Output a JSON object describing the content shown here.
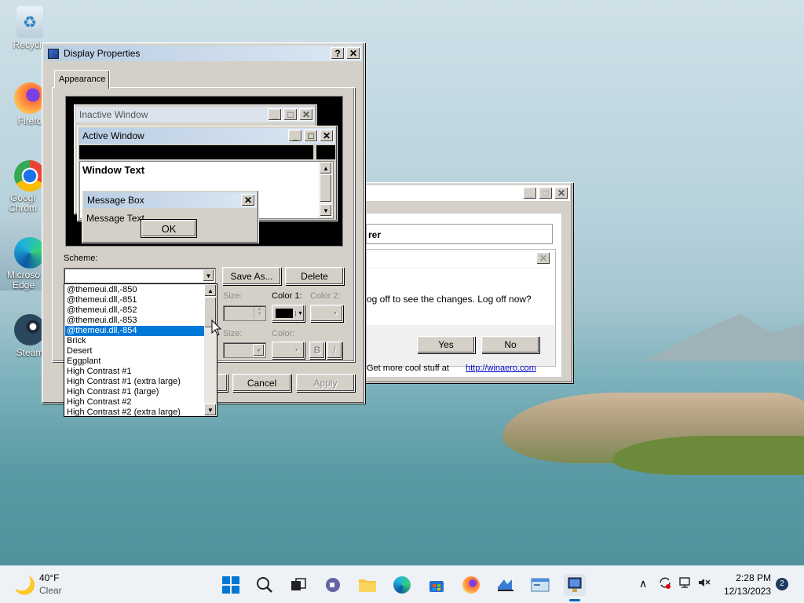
{
  "desktop": {
    "icons": [
      {
        "label": "Recycle",
        "icon": "recycle-bin-icon"
      },
      {
        "label": "Firefo",
        "icon": "firefox-icon"
      },
      {
        "label": "Googl Chrom",
        "icon": "chrome-icon"
      },
      {
        "label": "Microso Edge",
        "icon": "edge-icon"
      },
      {
        "label": "Steam",
        "icon": "steam-icon"
      }
    ]
  },
  "display_properties": {
    "title": "Display Properties",
    "help_btn": "?",
    "close_btn": "✕",
    "tab": "Appearance",
    "preview": {
      "inactive_title": "Inactive Window",
      "active_title": "Active Window",
      "window_text": "Window Text",
      "msgbox_title": "Message Box",
      "msgbox_text": "Message Text",
      "ok": "OK"
    },
    "scheme_label": "Scheme:",
    "scheme_value": "",
    "save_as": "Save As...",
    "delete": "Delete",
    "size_label": "Size:",
    "color1_label": "Color 1:",
    "color2_label": "Color 2:",
    "size2_label": "Size:",
    "color_label": "Color:",
    "bold_btn": "B",
    "italic_btn": "I",
    "cancel": "Cancel",
    "apply": "Apply",
    "scheme_list": [
      "@themeui.dll,-850",
      "@themeui.dll,-851",
      "@themeui.dll,-852",
      "@themeui.dll,-853",
      "@themeui.dll,-854",
      "Brick",
      "Desert",
      "Eggplant",
      "High Contrast #1",
      "High Contrast #1 (extra large)",
      "High Contrast #1 (large)",
      "High Contrast #2",
      "High Contrast #2 (extra large)"
    ],
    "selected_index": 4
  },
  "back_window": {
    "title_fragment": "rer",
    "prompt": "og off to see the changes. Log off now?",
    "yes": "Yes",
    "no": "No",
    "footer_text": "Get more cool stuff at",
    "footer_link": "http://winaero.com"
  },
  "taskbar": {
    "weather_temp": "40°F",
    "weather_cond": "Clear",
    "time": "2:28 PM",
    "date": "12/13/2023",
    "notif_count": "2"
  },
  "colors": {
    "selection": "#0078d7",
    "title_active": "#b9cde3",
    "accent": "#0067c0"
  }
}
